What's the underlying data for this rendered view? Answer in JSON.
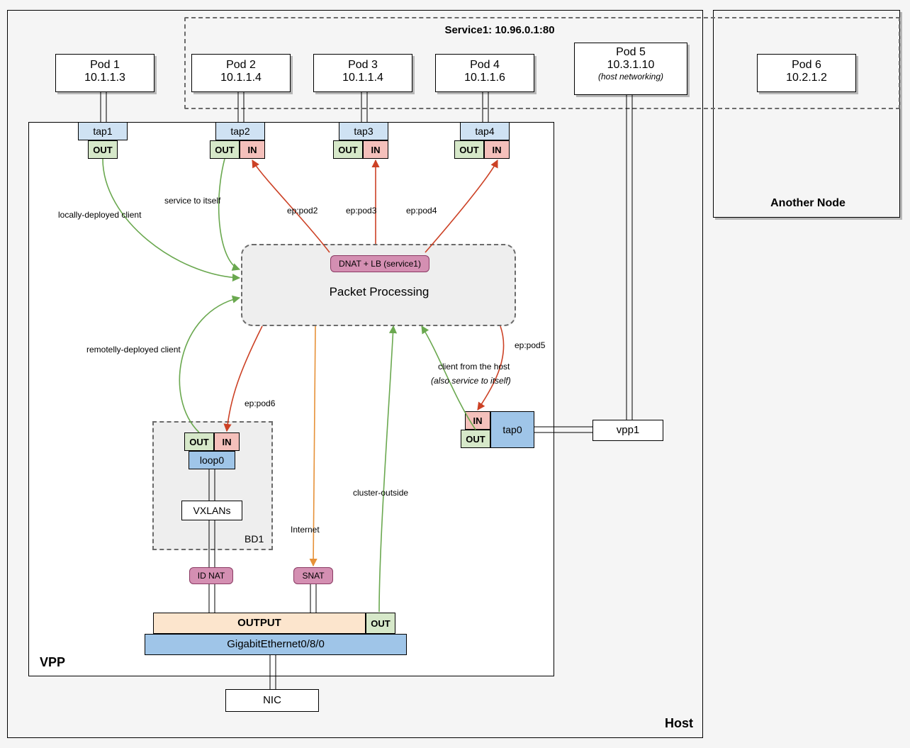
{
  "service": {
    "label": "Service1: 10.96.0.1:80"
  },
  "pods": {
    "p1": {
      "title": "Pod 1",
      "ip": "10.1.1.3"
    },
    "p2": {
      "title": "Pod 2",
      "ip": "10.1.1.4"
    },
    "p3": {
      "title": "Pod 3",
      "ip": "10.1.1.4"
    },
    "p4": {
      "title": "Pod 4",
      "ip": "10.1.1.6"
    },
    "p5": {
      "title": "Pod 5",
      "ip": "10.3.1.10",
      "note": "(host networking)"
    },
    "p6": {
      "title": "Pod 6",
      "ip": "10.2.1.2"
    }
  },
  "taps": {
    "t1": "tap1",
    "t2": "tap2",
    "t3": "tap3",
    "t4": "tap4",
    "t0": "tap0"
  },
  "tags": {
    "out": "OUT",
    "in": "IN"
  },
  "proc": {
    "title": "Packet Processing",
    "dnat": "DNAT + LB (service1)"
  },
  "bd1": {
    "loop": "loop0",
    "vxlans": "VXLANs",
    "label": "BD1"
  },
  "nat": {
    "id": "ID NAT",
    "snat": "SNAT"
  },
  "nic": {
    "output": "OUTPUT",
    "out": "OUT",
    "ge": "GigabitEthernet0/8/0",
    "nic": "NIC"
  },
  "labels": {
    "vpp": "VPP",
    "host": "Host",
    "another": "Another Node",
    "vpp1": "vpp1",
    "local_client": "locally-deployed client",
    "service_itself": "service to itself",
    "remote_client": "remotelly-deployed client",
    "ep_pod2": "ep:pod2",
    "ep_pod3": "ep:pod3",
    "ep_pod4": "ep:pod4",
    "ep_pod5": "ep:pod5",
    "ep_pod6": "ep:pod6",
    "cluster_outside": "cluster-outside",
    "internet": "Internet",
    "client_host1": "client from the host",
    "client_host2": "(also service to itself)"
  }
}
